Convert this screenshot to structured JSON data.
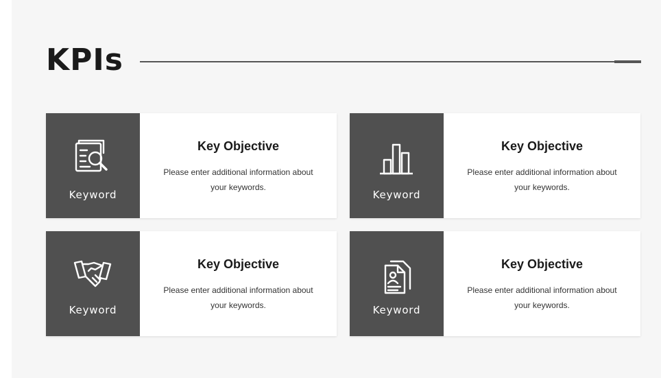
{
  "slide": {
    "title": "KPIs"
  },
  "colors": {
    "tile_background": "#505050",
    "card_background": "#ffffff",
    "slide_background": "#f6f6f6",
    "rule": "#555555"
  },
  "cards": [
    {
      "icon": "document-search-icon",
      "keyword": "Keyword",
      "title": "Key Objective",
      "description": "Please enter additional information about your keywords."
    },
    {
      "icon": "bar-chart-icon",
      "keyword": "Keyword",
      "title": "Key Objective",
      "description": "Please enter additional information about your keywords."
    },
    {
      "icon": "handshake-icon",
      "keyword": "Keyword",
      "title": "Key Objective",
      "description": "Please enter additional information about your keywords."
    },
    {
      "icon": "profile-document-icon",
      "keyword": "Keyword",
      "title": "Key Objective",
      "description": "Please enter additional information about your keywords."
    }
  ]
}
